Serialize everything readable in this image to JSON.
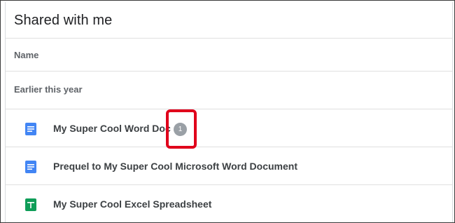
{
  "header": {
    "title": "Shared with me"
  },
  "columns": {
    "name": "Name"
  },
  "sections": [
    {
      "label": "Earlier this year"
    }
  ],
  "files": [
    {
      "name": "My Super Cool Word Doc",
      "icon": "google-docs-icon",
      "badge": "1"
    },
    {
      "name": "Prequel to My Super Cool Microsoft Word Document",
      "icon": "google-docs-icon"
    },
    {
      "name": "My Super Cool Excel Spreadsheet",
      "icon": "google-sheets-icon"
    }
  ],
  "colors": {
    "docs_blue": "#4285f4",
    "sheets_green": "#0f9d58",
    "highlight_red": "#e0001b",
    "badge_grey": "#9aa0a6"
  }
}
